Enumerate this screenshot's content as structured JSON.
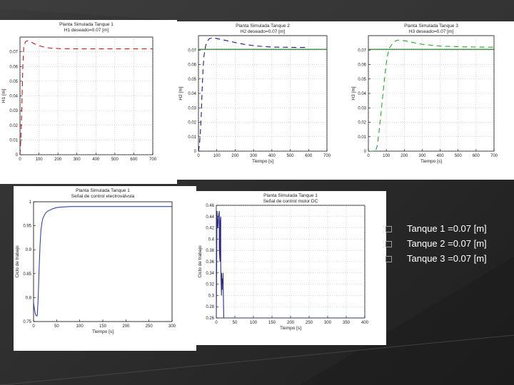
{
  "bullets": [
    "Tanque 1 =0.07 [m]",
    "Tanque 2 =0.07 [m]",
    "Tanque 3 =0.07 [m]"
  ],
  "colors": {
    "tank1": "#cc1111",
    "tank2": "#1a1a8c",
    "tank3": "#22aa22",
    "ref": "#1a6e1a",
    "signal": "#3344aa",
    "background": "#2e2e2e",
    "bullet_text": "#ffffff"
  },
  "chart_data": [
    {
      "type": "line",
      "title": "Planta Simulada Tanque 1",
      "subtitle": "H1 deseado=0.07 [m]",
      "xlabel": "",
      "ylabel": "H1 [m]",
      "xlim": [
        0,
        700
      ],
      "ylim": [
        0,
        0.08
      ],
      "xticks": [
        "0",
        "100",
        "200",
        "300",
        "400",
        "500",
        "600",
        "700"
      ],
      "yticks": [
        "0",
        "0.01",
        "0.02",
        "0.03",
        "0.04",
        "0.05",
        "0.06",
        "0.07"
      ],
      "grid": true,
      "series": [
        {
          "style": "dashed",
          "color": "#cc1111",
          "x": [
            0,
            5,
            10,
            15,
            20,
            30,
            40,
            60,
            80,
            100,
            130,
            160,
            200,
            250,
            300,
            350,
            400,
            500,
            600,
            700
          ],
          "y": [
            0,
            0.012,
            0.035,
            0.06,
            0.074,
            0.077,
            0.0775,
            0.0765,
            0.0752,
            0.0742,
            0.0731,
            0.0725,
            0.0722,
            0.0721,
            0.072,
            0.072,
            0.072,
            0.072,
            0.072,
            0.072
          ]
        }
      ]
    },
    {
      "type": "line",
      "title": "Planta Simulada Tanque 2",
      "subtitle": "H2 deseado=0.07 [m]",
      "xlabel": "Tiempo [s]",
      "ylabel": "H2 [m]",
      "xlim": [
        0,
        700
      ],
      "ylim": [
        0,
        0.08
      ],
      "xticks": [
        "0",
        "100",
        "200",
        "300",
        "400",
        "500",
        "600",
        "700"
      ],
      "yticks": [
        "0",
        "0.01",
        "0.02",
        "0.03",
        "0.04",
        "0.05",
        "0.06",
        "0.07"
      ],
      "grid": true,
      "series": [
        {
          "name": "",
          "style": "solid",
          "color": "#1a6e1a",
          "x": [
            0,
            700
          ],
          "y": [
            0.0705,
            0.0705
          ]
        },
        {
          "style": "dashed",
          "color": "#1a1a8c",
          "x": [
            0,
            5,
            10,
            15,
            20,
            25,
            30,
            40,
            50,
            60,
            80,
            100,
            130,
            160,
            200,
            250,
            300,
            350,
            400,
            450,
            500,
            550,
            600
          ],
          "y": [
            0,
            0.004,
            0.012,
            0.025,
            0.042,
            0.057,
            0.066,
            0.0735,
            0.0765,
            0.078,
            0.0785,
            0.078,
            0.0772,
            0.0764,
            0.0752,
            0.074,
            0.0731,
            0.0725,
            0.0721,
            0.072,
            0.0719,
            0.0718,
            0.0718
          ]
        }
      ]
    },
    {
      "type": "line",
      "title": "Planta Simulada Tanque 3",
      "subtitle": "H3 deseado=0.07 [m]",
      "xlabel": "Tiempo [s]",
      "ylabel": "H3 [m]",
      "xlim": [
        0,
        700
      ],
      "ylim": [
        0,
        0.08
      ],
      "xticks": [
        "0",
        "100",
        "200",
        "300",
        "400",
        "500",
        "600",
        "700"
      ],
      "yticks": [
        "0",
        "0.01",
        "0.02",
        "0.03",
        "0.04",
        "0.05",
        "0.06",
        "0.07"
      ],
      "grid": true,
      "series": [
        {
          "name": "",
          "style": "solid",
          "color": "#1a6e1a",
          "x": [
            0,
            700
          ],
          "y": [
            0.0705,
            0.0705
          ]
        },
        {
          "style": "dashed",
          "color": "#22aa22",
          "x": [
            0,
            20,
            40,
            50,
            60,
            70,
            80,
            90,
            100,
            110,
            120,
            140,
            160,
            180,
            200,
            250,
            300,
            400,
            500,
            600,
            700
          ],
          "y": [
            0,
            0,
            0,
            0.004,
            0.014,
            0.026,
            0.038,
            0.05,
            0.061,
            0.068,
            0.072,
            0.0755,
            0.0768,
            0.077,
            0.0765,
            0.0752,
            0.074,
            0.0728,
            0.0723,
            0.0721,
            0.072
          ]
        }
      ]
    },
    {
      "type": "line",
      "title": "Planta Simulada Tanque 1",
      "subtitle": "Señal de control electroválvula",
      "xlabel": "Tiempo [s]",
      "ylabel": "Ciclo de trabajo",
      "xlim": [
        0,
        300
      ],
      "ylim": [
        0.75,
        1.0
      ],
      "xticks": [
        "0",
        "50",
        "100",
        "150",
        "200",
        "250",
        "300"
      ],
      "yticks": [
        "0.75",
        "0.8",
        "0.85",
        "0.9",
        "0.95",
        "1"
      ],
      "grid": false,
      "series": [
        {
          "style": "solid",
          "color": "#3344aa",
          "x": [
            0,
            2,
            4,
            6,
            8,
            10,
            12,
            14,
            16,
            18,
            20,
            25,
            30,
            40,
            50,
            60,
            80,
            100,
            150,
            200,
            250,
            300
          ],
          "y": [
            0.79,
            0.775,
            0.765,
            0.762,
            0.762,
            0.8,
            0.86,
            0.91,
            0.94,
            0.955,
            0.965,
            0.975,
            0.98,
            0.985,
            0.988,
            0.989,
            0.99,
            0.99,
            0.99,
            0.99,
            0.99,
            0.99
          ]
        }
      ]
    },
    {
      "type": "line",
      "title": "Planta Simulada Tanque 1",
      "subtitle": "Señal de control motor DC",
      "xlabel": "Tiempo [s]",
      "ylabel": "Ciclo de trabajo",
      "xlim": [
        0,
        400
      ],
      "ylim": [
        0.26,
        0.46
      ],
      "xticks": [
        "0",
        "50",
        "100",
        "150",
        "200",
        "250",
        "300",
        "350",
        "400"
      ],
      "yticks": [
        "0.26",
        "0.28",
        "0.3",
        "0.32",
        "0.34",
        "0.36",
        "0.38",
        "0.4",
        "0.42",
        "0.44",
        "0.46"
      ],
      "grid": true,
      "series": [
        {
          "style": "solid",
          "color": "#2a2a88",
          "x": [
            0,
            2,
            4,
            6,
            8,
            8,
            10,
            10,
            12,
            12,
            14,
            14,
            16,
            16,
            18,
            18,
            20,
            20,
            400
          ],
          "y": [
            0.26,
            0.45,
            0.42,
            0.44,
            0.45,
            0.38,
            0.36,
            0.43,
            0.44,
            0.35,
            0.3,
            0.34,
            0.31,
            0.33,
            0.32,
            0.34,
            0.26,
            0.26,
            0.26
          ]
        }
      ]
    }
  ]
}
